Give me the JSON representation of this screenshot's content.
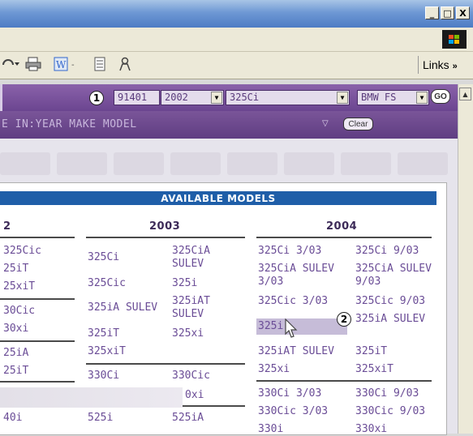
{
  "window": {
    "minimize": "_",
    "maximize": "□",
    "close": "X"
  },
  "toolbar": {
    "links_label": "Links",
    "links_chevron": "»"
  },
  "search": {
    "step1": "1",
    "zip": "91401",
    "year": "2002",
    "model": "325Ci",
    "make": "BMW FS",
    "go_label": "GO"
  },
  "refine": {
    "text": "E IN:YEAR MAKE MODEL",
    "clear_label": "Clear"
  },
  "panel": {
    "title": "AVAILABLE MODELS",
    "step2": "2",
    "col2002": {
      "year": "2",
      "items": [
        "325Cic",
        "25iT",
        "25xiT",
        "30Cic",
        "30xi",
        "25iA",
        "25iT",
        "0xi",
        "40i"
      ]
    },
    "col2003": {
      "year": "2003",
      "items": [
        "325Ci",
        "325CiA SULEV",
        "325Cic",
        "325i",
        "325iA SULEV",
        "325iAT SULEV",
        "325iT",
        "325xi",
        "325xiT",
        "330Ci",
        "330Cic",
        "525i",
        "525iA"
      ]
    },
    "col2004": {
      "year": "2004",
      "items": [
        "325Ci 3/03",
        "325Ci 9/03",
        "325CiA SULEV 3/03",
        "325CiA SULEV 9/03",
        "325Cic 3/03",
        "325Cic 9/03",
        "325i",
        "325iA SULEV",
        "325iAT SULEV",
        "325iT",
        "325xi",
        "325xiT",
        "330Ci 3/03",
        "330Ci 9/03",
        "330Cic 3/03",
        "330Cic 9/03",
        "330i",
        "330xi"
      ]
    }
  }
}
